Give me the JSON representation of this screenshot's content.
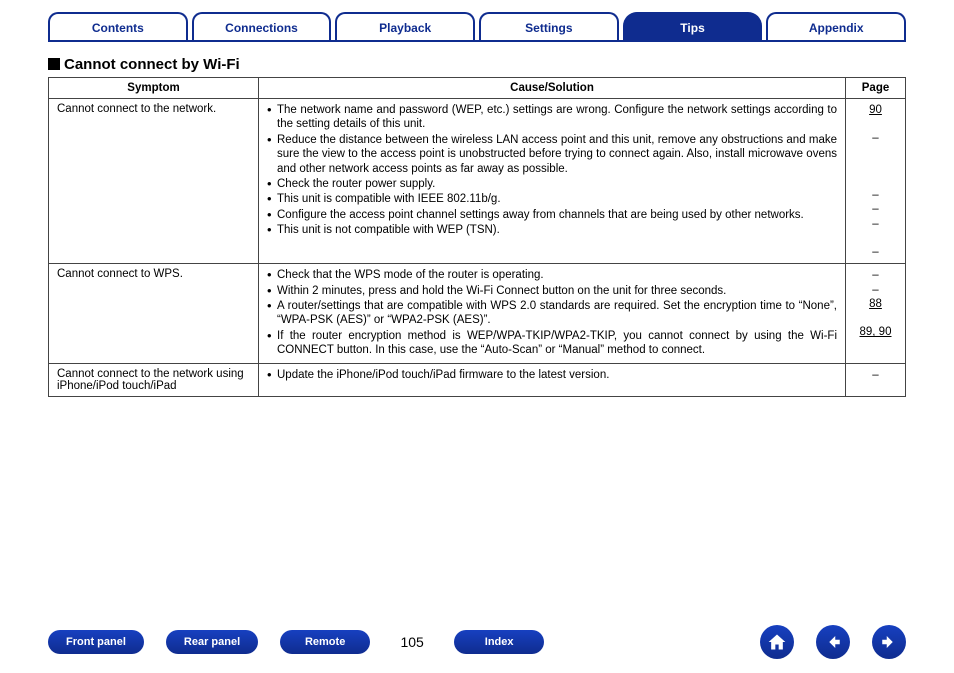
{
  "tabs": [
    {
      "label": "Contents",
      "active": false
    },
    {
      "label": "Connections",
      "active": false
    },
    {
      "label": "Playback",
      "active": false
    },
    {
      "label": "Settings",
      "active": false
    },
    {
      "label": "Tips",
      "active": true
    },
    {
      "label": "Appendix",
      "active": false
    }
  ],
  "section_title": "Cannot connect by Wi-Fi",
  "table": {
    "headers": {
      "symptom": "Symptom",
      "cause": "Cause/Solution",
      "page": "Page"
    },
    "rows": [
      {
        "symptom": "Cannot connect to the network.",
        "causes": [
          "The network name and password (WEP, etc.) settings are wrong. Configure the network settings according to the setting details of this unit.",
          "Reduce the distance between the wireless LAN access point and this unit, remove any obstructions and make sure the view to the access point is unobstructed before trying to connect again. Also, install microwave ovens and other network access points as far away as possible.",
          "Check the router power supply.",
          "This unit is compatible with IEEE 802.11b/g.",
          "Configure the access point channel settings away from channels that are being used by other networks.",
          "This unit is not compatible with WEP (TSN)."
        ],
        "pages": [
          "90",
          "",
          "–",
          "",
          "",
          "",
          "–",
          "–",
          "–",
          "",
          "–"
        ]
      },
      {
        "symptom": "Cannot connect to WPS.",
        "causes": [
          "Check that the WPS mode of the router is operating.",
          "Within 2 minutes, press and hold the Wi-Fi Connect button on the unit for three seconds.",
          "A router/settings that are compatible with WPS 2.0 standards are required. Set the encryption time to “None”, “WPA-PSK (AES)” or “WPA2-PSK (AES)”.",
          "If the router encryption method is WEP/WPA-TKIP/WPA2-TKIP, you cannot connect by using the Wi-Fi CONNECT button. In this case, use the “Auto-Scan” or “Manual” method to connect."
        ],
        "pages": [
          "–",
          "–",
          "88",
          "",
          "89, 90"
        ]
      },
      {
        "symptom": "Cannot connect to the network using iPhone/iPod touch/iPad",
        "causes": [
          "Update the iPhone/iPod touch/iPad firmware to the latest version."
        ],
        "pages": [
          "–"
        ]
      }
    ]
  },
  "footer": {
    "buttons": [
      "Front panel",
      "Rear panel",
      "Remote",
      "Index"
    ],
    "page_number": "105"
  }
}
